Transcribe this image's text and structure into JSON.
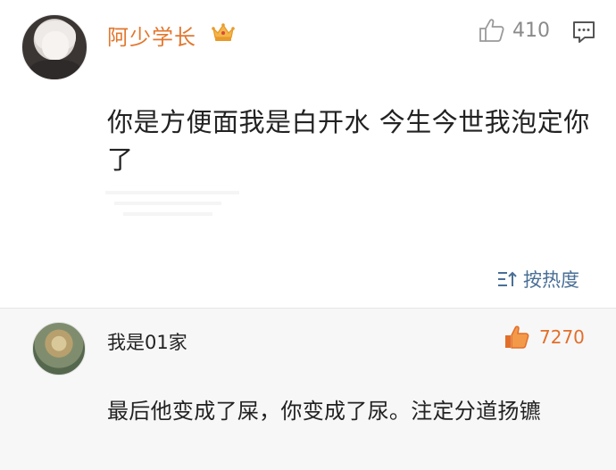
{
  "post": {
    "username": "阿少学长",
    "badge_icon": "crown-icon",
    "like_count": "410",
    "content": "你是方便面我是白开水  今生今世我泡定你了",
    "sort_label": "按热度",
    "colors": {
      "username": "#e2772e",
      "sort": "#4a6f96"
    }
  },
  "reply": {
    "username": "我是01家",
    "like_count": "7270",
    "content": "最后他变成了屎，你变成了尿。注定分道扬镳",
    "colors": {
      "like": "#e36e2a"
    }
  }
}
